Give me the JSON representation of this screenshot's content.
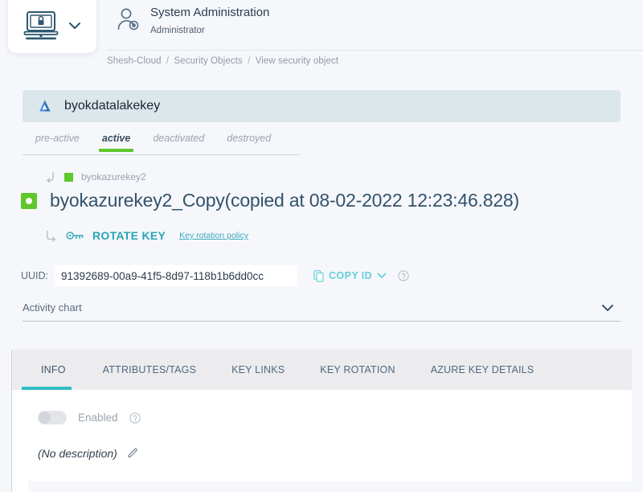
{
  "header": {
    "logo_icon": "laptop-lock-icon",
    "logo_chevron_icon": "chevron-down-icon",
    "account_icon": "user-gear-icon",
    "account_title": "System Administration",
    "account_role": "Administrator"
  },
  "breadcrumb": {
    "items": [
      "Shesh-Cloud",
      "Security Objects",
      "View security object"
    ],
    "separator": "/"
  },
  "group_banner": {
    "icon": "azure-icon",
    "label": "byokdatalakekey"
  },
  "state_tabs": {
    "items": [
      {
        "label": "pre-active",
        "active": false
      },
      {
        "label": "active",
        "active": true
      },
      {
        "label": "deactivated",
        "active": false
      },
      {
        "label": "destroyed",
        "active": false
      }
    ]
  },
  "parent_key": {
    "return_icon": "return-arrow-icon",
    "status_icon": "green-square-icon",
    "name": "byokazurekey2"
  },
  "key": {
    "status_icon": "green-square-dot-icon",
    "title": "byokazurekey2_Copy(copied at 08-02-2022 12:23:46.828)"
  },
  "rotate": {
    "arrow_icon": "corner-arrow-icon",
    "key_icon": "key-icon",
    "label": "ROTATE KEY",
    "policy_link": "Key rotation policy"
  },
  "uuid": {
    "label": "UUID:",
    "value": "91392689-00a9-41f5-8d97-118b1b6dd0cc",
    "placeholder": "UUID",
    "copy_icon": "copy-icon",
    "copy_label": "COPY ID",
    "copy_chevron_icon": "chevron-down-icon",
    "help_icon": "help-circle-icon"
  },
  "activity": {
    "label": "Activity chart",
    "chevron_icon": "chevron-down-icon"
  },
  "detail_tabs": {
    "items": [
      {
        "label": "INFO",
        "active": true
      },
      {
        "label": "ATTRIBUTES/TAGS",
        "active": false
      },
      {
        "label": "KEY LINKS",
        "active": false
      },
      {
        "label": "KEY ROTATION",
        "active": false
      },
      {
        "label": "AZURE KEY DETAILS",
        "active": false
      }
    ]
  },
  "info_panel": {
    "toggle_label": "Enabled",
    "toggle_state": "off",
    "toggle_help_icon": "help-circle-icon",
    "description": "(No description)",
    "edit_icon": "pencil-icon"
  },
  "colors": {
    "page_background": "#f6f7fb",
    "accent_teal": "#32bdc8",
    "accent_green": "#5fc72b",
    "banner_background": "#dce7ec",
    "tabbar_background": "#ececee",
    "heading_text": "#31536b",
    "muted_text": "#9aa3ad"
  }
}
